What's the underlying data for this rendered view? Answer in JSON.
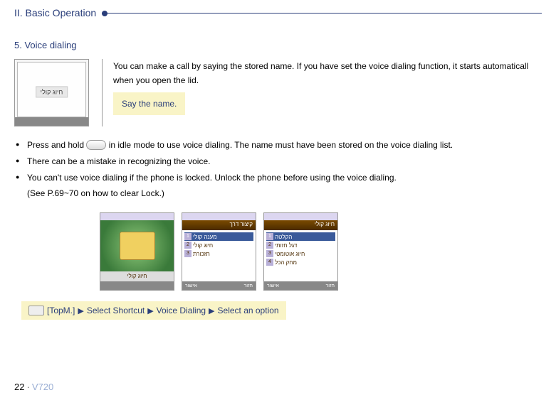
{
  "header": {
    "title": "II. Basic Operation"
  },
  "section": {
    "title": "5. Voice dialing"
  },
  "intro": {
    "line1": "You can make a call by saying the stored name. If you have set the voice dialing function, it starts automaticall",
    "line2": "when you open the lid.",
    "highlight": "Say the name."
  },
  "bullets": {
    "b1_pre": "Press and hold ",
    "b1_post": " in idle mode to use voice dialing. The name must have been stored on the voice dialing list.",
    "b2": "There can be a mistake in recognizing the voice.",
    "b3": "You can't use voice dialing if the phone is locked. Unlock the phone before using the voice dialing.",
    "b3sub": "(See P.69~70 on how to clear Lock.)"
  },
  "screens": {
    "s1": {
      "label": "חיוג קולי"
    },
    "s2": {
      "header": "קיצור דרך",
      "items": [
        "מענה קולי",
        "חיוג קולי",
        "תזכורת"
      ],
      "footer_left": "חזור",
      "footer_right": "אישור"
    },
    "s3": {
      "header": "חיוג קולי",
      "items": [
        "הקלטה",
        "דגל חזותי",
        "חיוג אוטומטי",
        "מחק הכל"
      ],
      "footer_left": "חזור",
      "footer_right": "אישור"
    }
  },
  "idle_screen": {
    "text": "חיוג קולי"
  },
  "path": {
    "seg1": "[TopM.]",
    "seg2": "Select Shortcut",
    "seg3": "Voice Dialing",
    "seg4": "Select an option"
  },
  "footer": {
    "page": "22",
    "model": "V720"
  }
}
